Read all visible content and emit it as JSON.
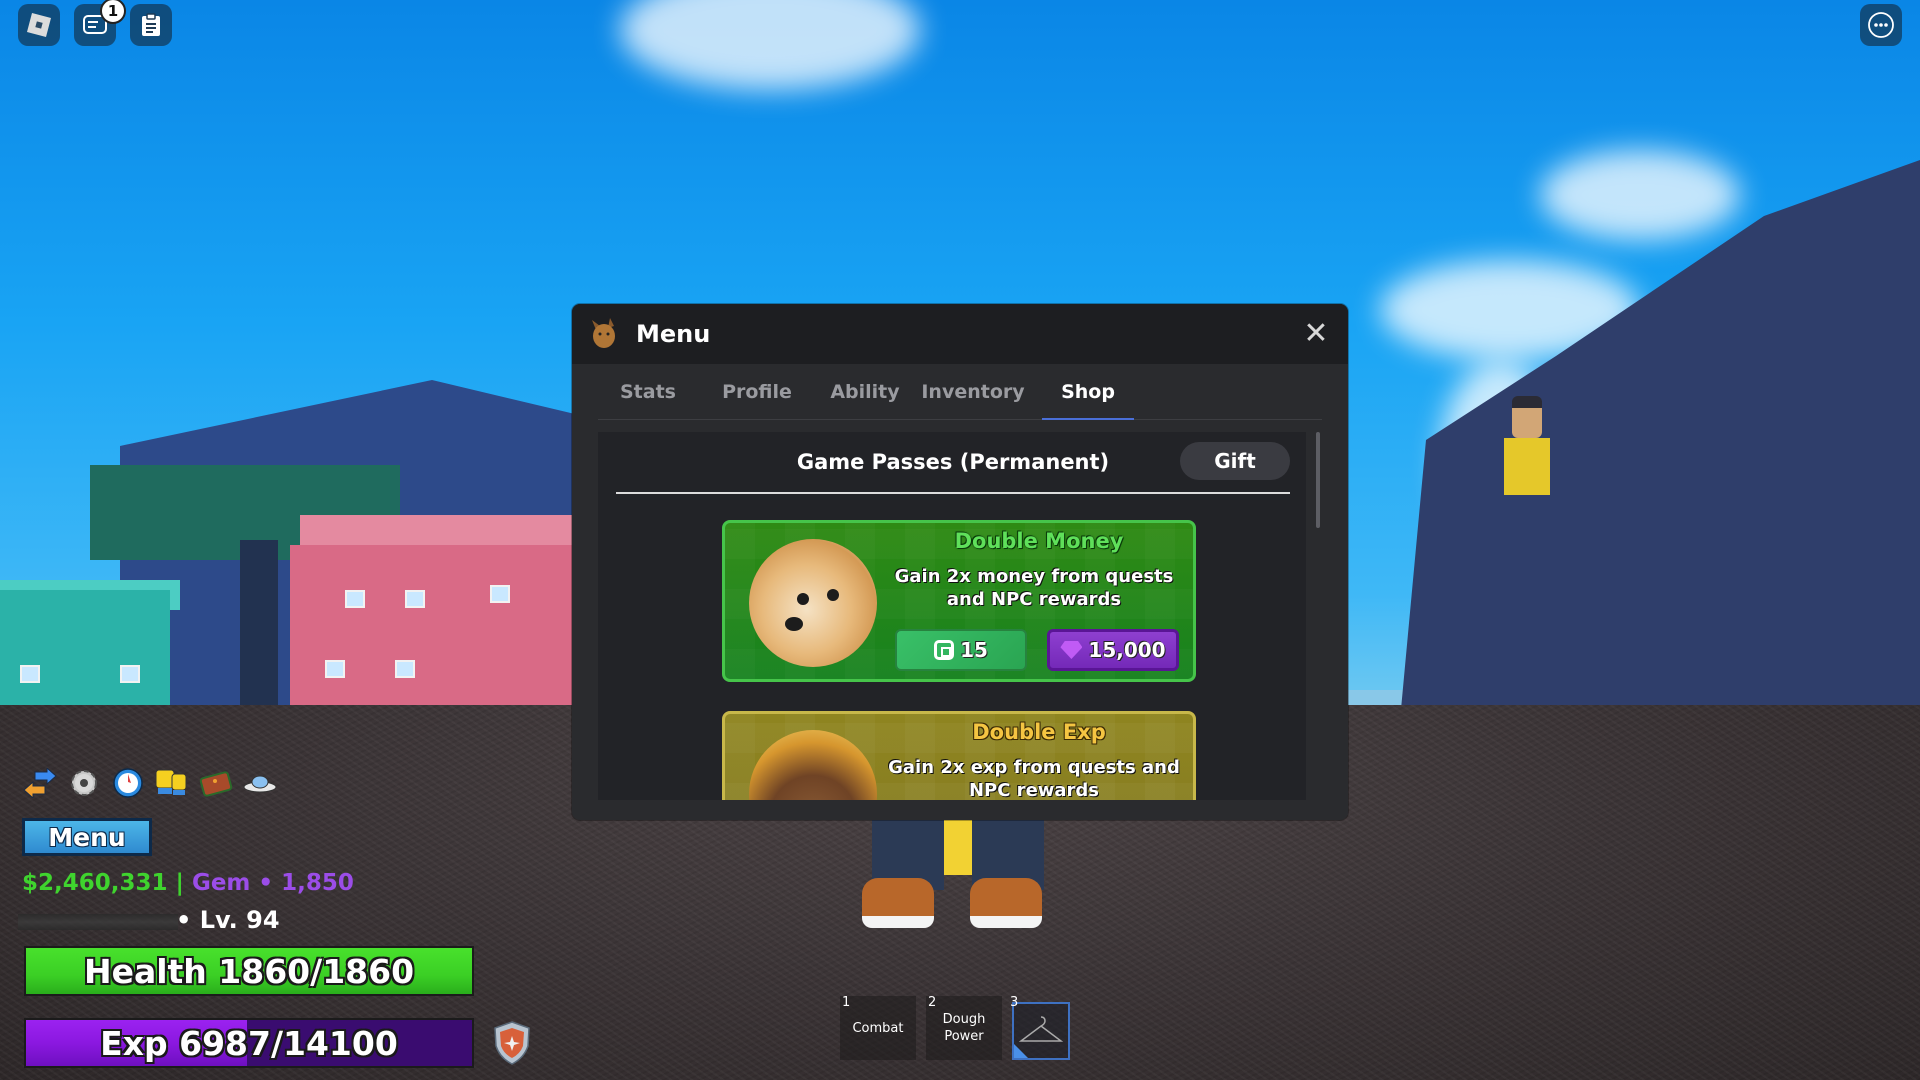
{
  "topbar": {
    "roblox_button": "roblox-logo",
    "chat_badge_count": "1",
    "more_button": "more-options"
  },
  "menu_window": {
    "title": "Menu",
    "close_label": "✕",
    "tabs": [
      {
        "label": "Stats",
        "active": false
      },
      {
        "label": "Profile",
        "active": false
      },
      {
        "label": "Ability",
        "active": false
      },
      {
        "label": "Inventory",
        "active": false
      },
      {
        "label": "Shop",
        "active": true
      }
    ],
    "shop": {
      "section_title": "Game Passes (Permanent)",
      "gift_label": "Gift",
      "passes": [
        {
          "name": "Double Money",
          "description": "Gain 2x money from quests and NPC rewards",
          "price_robux": "15",
          "price_gems": "15,000",
          "theme": "green"
        },
        {
          "name": "Double Exp",
          "description": "Gain 2x exp from quests and NPC rewards",
          "theme": "gold"
        }
      ]
    }
  },
  "hud": {
    "icons": [
      "swap-icon",
      "settings-gear-icon",
      "compass-icon",
      "friends-icon",
      "wallet-icon",
      "ufo-icon"
    ],
    "menu_button_label": "Menu",
    "money": "$2,460,331",
    "separator": " | ",
    "gems": "Gem • 1,850",
    "level": "• Lv. 94",
    "health": {
      "label": "Health 1860/1860",
      "current": 1860,
      "max": 1860
    },
    "exp": {
      "label": "Exp 6987/14100",
      "current": 6987,
      "max": 14100
    },
    "colors": {
      "health": "#3bcf25",
      "exp": "#8b18e0",
      "money": "#3fd42e",
      "gems": "#9b4de8"
    }
  },
  "hotbar": {
    "slots": [
      {
        "number": "1",
        "label": "Combat"
      },
      {
        "number": "2",
        "label": "Dough Power"
      },
      {
        "number": "3",
        "label": "",
        "icon": "clothes-hanger-icon",
        "selected": true
      }
    ]
  }
}
